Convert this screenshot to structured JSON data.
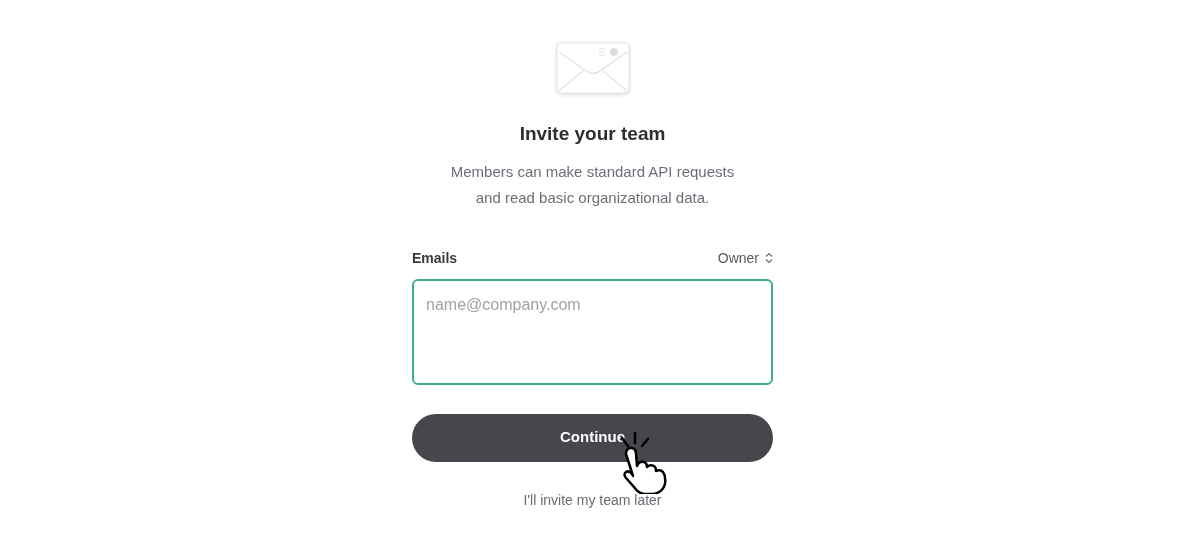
{
  "title": "Invite your team",
  "subtitle_lines": [
    "Members can make standard API requests",
    "and read basic organizational data."
  ],
  "emails_label": "Emails",
  "role_select": {
    "value": "Owner"
  },
  "emails_field": {
    "placeholder": "name@company.com",
    "focused": true
  },
  "continue_button": {
    "label": "Continue"
  },
  "skip_link": "I'll invite my team later"
}
